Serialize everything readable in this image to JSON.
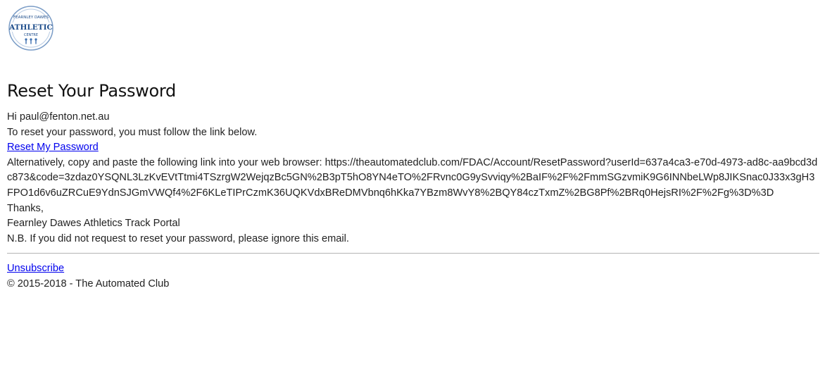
{
  "logo": {
    "text_top": "FEARNLEY DAWES",
    "text_main": "ATHLETIC",
    "text_sub": "CENTRE",
    "color": "#1f4e8c"
  },
  "email": {
    "heading": "Reset Your Password",
    "greeting": "Hi paul@fenton.net.au",
    "instruction": "To reset your password, you must follow the link below.",
    "reset_link_label": "Reset My Password",
    "alt_intro": "Alternatively, copy and paste the following link into your web browser: ",
    "reset_url": "https://theautomatedclub.com/FDAC/Account/ResetPassword?userId=637a4ca3-e70d-4973-ad8c-aa9bcd3dc873&code=3zdaz0YSQNL3LzKvEVtTtmi4TSzrgW2WejqzBc5GN%2B3pT5hO8YN4eTO%2FRvnc0G9ySvviqy%2BaIF%2F%2FmmSGzvmiK9G6INNbeLWp8JIKSnac0J33x3gH3FPO1d6v6uZRCuE9YdnSJGmVWQf4%2F6KLeTIPrCzmK36UQKVdxBReDMVbnq6hKka7YBzm8WvY8%2BQY84czTxmZ%2BG8Pf%2BRq0HejsRI%2F%2Fg%3D%3D",
    "thanks": "Thanks,",
    "signature": "Fearnley Dawes Athletics Track Portal",
    "note": "N.B. If you did not request to reset your password, please ignore this email."
  },
  "footer": {
    "unsubscribe_label": "Unsubscribe",
    "copyright": "© 2015-2018 - The Automated Club"
  },
  "colors": {
    "link": "#0000ee",
    "text": "#222222",
    "divider": "#b5b5b5"
  }
}
